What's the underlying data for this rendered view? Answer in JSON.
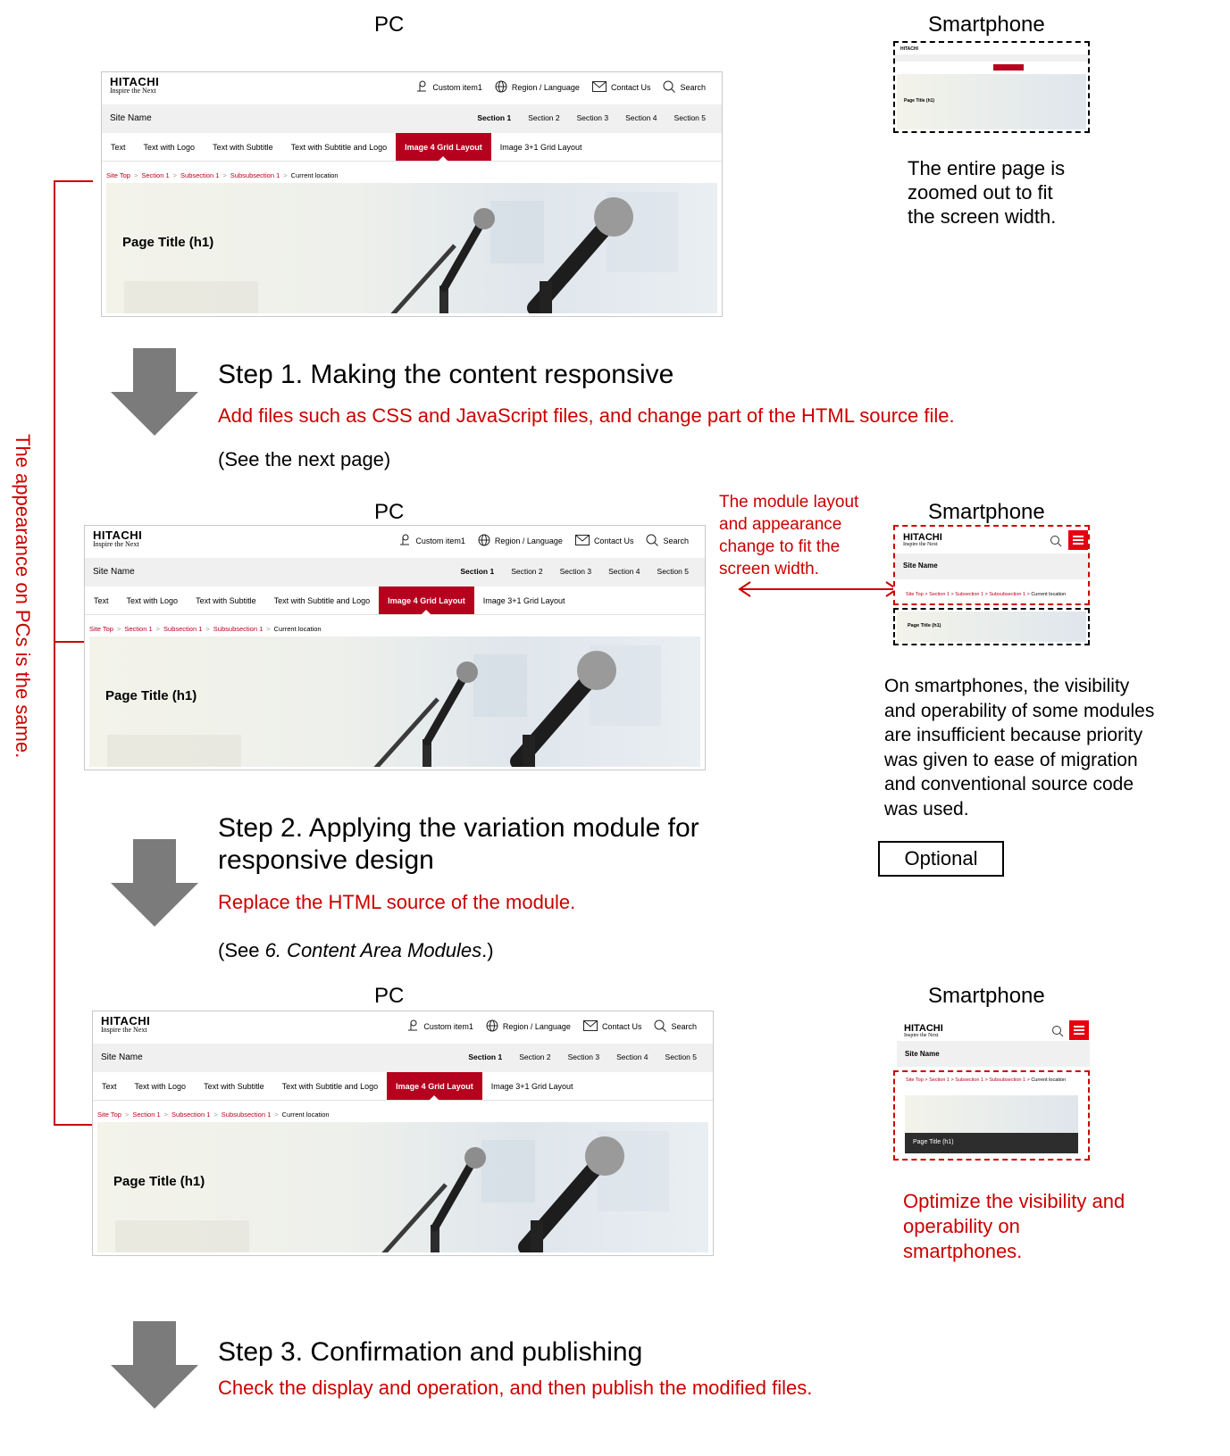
{
  "labels": {
    "pc": "PC",
    "smartphone": "Smartphone",
    "side_note": "The appearance on PCs is the same."
  },
  "top_note": [
    "The entire page is",
    "zoomed out to fit",
    "the screen width."
  ],
  "step1": {
    "title": "Step 1. Making the content responsive",
    "desc": "Add files such as CSS and JavaScript files, and change part of the HTML source file.",
    "ref": "(See the next page)"
  },
  "module_note": [
    "The module layout",
    "and appearance",
    "change to fit the",
    "screen width."
  ],
  "mid_note": [
    "On smartphones, the visibility",
    "and operability of some modules",
    "are insufficient because priority",
    "was given to ease of migration",
    "and conventional source code",
    "was used."
  ],
  "optional": "Optional",
  "step2": {
    "title_line1": "Step 2. Applying the variation module for",
    "title_line2": "responsive design",
    "desc": "Replace the HTML source of the module.",
    "ref_prefix": "(See ",
    "ref_italic": "6. Content Area Modules",
    "ref_suffix": ".)"
  },
  "bottom_note": [
    "Optimize the visibility and",
    "operability on",
    "smartphones."
  ],
  "step3": {
    "title": "Step 3. Confirmation and publishing",
    "desc": "Check the display and operation, and then publish the modified files."
  },
  "mock": {
    "logo_word": "HITACHI",
    "logo_tag": "Inspire the Next",
    "util": [
      "Custom item1",
      "Region / Language",
      "Contact Us",
      "Search"
    ],
    "site_name": "Site Name",
    "sections": [
      "Section 1",
      "Section 2",
      "Section 3",
      "Section 4",
      "Section 5"
    ],
    "tabs": [
      "Text",
      "Text with Logo",
      "Text with Subtitle",
      "Text with Subtitle and Logo",
      "Image 4 Grid Layout",
      "Image 3+1 Grid Layout"
    ],
    "crumbs": [
      "Site Top",
      "Section 1",
      "Subsection 1",
      "Subsubsection 1"
    ],
    "current": "Current location",
    "page_title": "Page Title (h1)"
  },
  "colors": {
    "accent": "#cc0000",
    "tab_active": "#b5001e",
    "arrow": "#7b7b7b",
    "menu": "#e60012"
  }
}
